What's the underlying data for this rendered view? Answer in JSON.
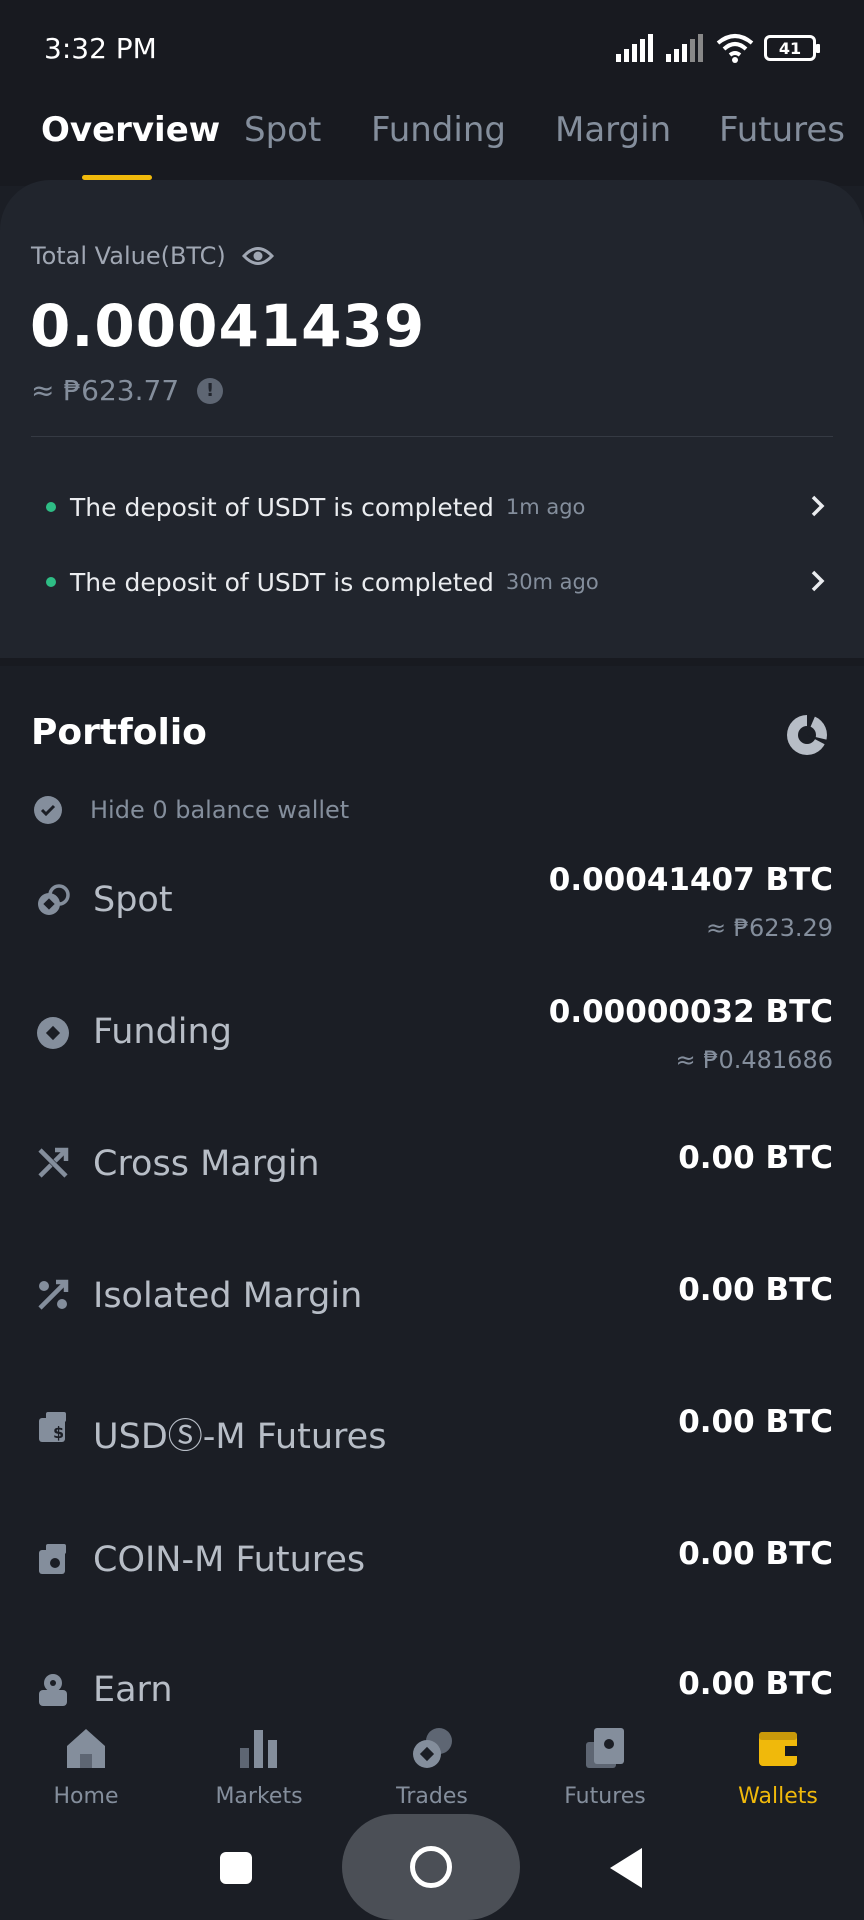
{
  "status_bar": {
    "time": "3:32 PM",
    "battery": "41"
  },
  "tabs": [
    {
      "label": "Overview"
    },
    {
      "label": "Spot"
    },
    {
      "label": "Funding"
    },
    {
      "label": "Margin"
    },
    {
      "label": "Futures"
    }
  ],
  "overview": {
    "total_label": "Total Value(BTC)",
    "total_value": "0.00041439",
    "total_fiat": "≈ ₱623.77",
    "notices": [
      {
        "text": "The deposit of USDT is completed",
        "time": "1m ago"
      },
      {
        "text": "The deposit of USDT is completed",
        "time": "30m ago"
      }
    ]
  },
  "portfolio": {
    "title": "Portfolio",
    "hide_zero_label": "Hide 0 balance wallet",
    "wallets": [
      {
        "name": "Spot",
        "amount": "0.00041407 BTC",
        "fiat": "≈ ₱623.29",
        "icon": "spot-icon"
      },
      {
        "name": "Funding",
        "amount": "0.00000032 BTC",
        "fiat": "≈ ₱0.481686",
        "icon": "funding-icon"
      },
      {
        "name": "Cross Margin",
        "amount": "0.00 BTC",
        "icon": "cross-margin-icon"
      },
      {
        "name": "Isolated Margin",
        "amount": "0.00 BTC",
        "icon": "isolated-margin-icon"
      },
      {
        "name": "USDⓈ-M Futures",
        "amount": "0.00 BTC",
        "icon": "usds-futures-icon"
      },
      {
        "name": "COIN-M Futures",
        "amount": "0.00 BTC",
        "icon": "coin-futures-icon"
      },
      {
        "name": "Earn",
        "amount": "0.00 BTC",
        "icon": "earn-icon"
      }
    ]
  },
  "bottom_nav": [
    {
      "label": "Home",
      "icon": "home-icon"
    },
    {
      "label": "Markets",
      "icon": "markets-icon"
    },
    {
      "label": "Trades",
      "icon": "trades-icon"
    },
    {
      "label": "Futures",
      "icon": "futures-icon"
    },
    {
      "label": "Wallets",
      "icon": "wallets-icon",
      "active": true
    }
  ],
  "colors": {
    "accent": "#f0b90b",
    "positive": "#2ebd85",
    "background": "#1b1e25",
    "card": "#21252d"
  }
}
